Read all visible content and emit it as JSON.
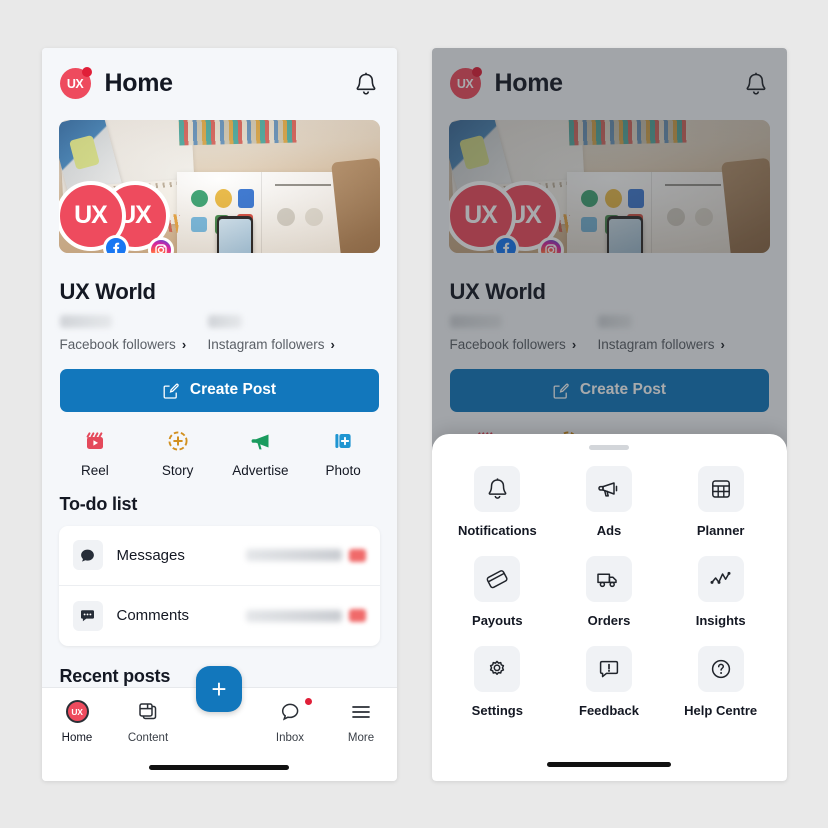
{
  "app": {
    "brand_initials": "UX",
    "title": "Home",
    "notification_icon": "bell-icon"
  },
  "profile": {
    "name": "UX World",
    "facebook_followers_count": "",
    "facebook_followers_label": "Facebook followers",
    "instagram_followers_count": "",
    "instagram_followers_label": "Instagram followers",
    "chevron": "›",
    "avatar_initials_1": "UX",
    "avatar_initials_2": "UX",
    "badge_facebook": "facebook-icon",
    "badge_instagram": "instagram-icon"
  },
  "create_post": {
    "label": "Create Post",
    "icon": "compose-icon",
    "color": "#1277bc"
  },
  "quick_actions": [
    {
      "label": "Reel",
      "icon": "reel-icon",
      "color": "#e4495b"
    },
    {
      "label": "Story",
      "icon": "story-plus-icon",
      "color": "#d2901f"
    },
    {
      "label": "Advertise",
      "icon": "megaphone-icon",
      "color": "#1a9b5e"
    },
    {
      "label": "Photo",
      "icon": "photo-plus-icon",
      "color": "#1f95d1"
    }
  ],
  "todo": {
    "title": "To-do list",
    "items": [
      {
        "label": "Messages",
        "icon": "message-bubble-icon",
        "status": "",
        "badge": ""
      },
      {
        "label": "Comments",
        "icon": "comment-bubble-icon",
        "status": "",
        "badge": ""
      }
    ]
  },
  "recent_posts": {
    "title": "Recent posts"
  },
  "bottom_nav": {
    "fab_label": "+",
    "items": [
      {
        "label": "Home",
        "icon": "ux-avatar-icon",
        "active": true,
        "dot": false
      },
      {
        "label": "Content",
        "icon": "content-cards-icon",
        "active": false,
        "dot": false
      },
      {
        "label": "Inbox",
        "icon": "inbox-bubble-icon",
        "active": false,
        "dot": true
      },
      {
        "label": "More",
        "icon": "hamburger-menu-icon",
        "active": false,
        "dot": false
      }
    ]
  },
  "sheet": {
    "handle": "drag-handle",
    "items": [
      {
        "label": "Notifications",
        "icon": "bell-icon"
      },
      {
        "label": "Ads",
        "icon": "megaphone-outline-icon"
      },
      {
        "label": "Planner",
        "icon": "calendar-grid-icon"
      },
      {
        "label": "Payouts",
        "icon": "card-icon"
      },
      {
        "label": "Orders",
        "icon": "truck-icon"
      },
      {
        "label": "Insights",
        "icon": "line-chart-icon"
      },
      {
        "label": "Settings",
        "icon": "gear-icon"
      },
      {
        "label": "Feedback",
        "icon": "feedback-bubble-icon"
      },
      {
        "label": "Help Centre",
        "icon": "question-circle-icon"
      }
    ]
  },
  "theme": {
    "page_bg": "#e9e9e9",
    "screen_bg": "#f5f7fa",
    "accent_blue": "#1277bc",
    "brand_red": "#ee4b5e",
    "text_dark": "#141823",
    "scrim": "rgba(38,42,48,0.40)"
  }
}
